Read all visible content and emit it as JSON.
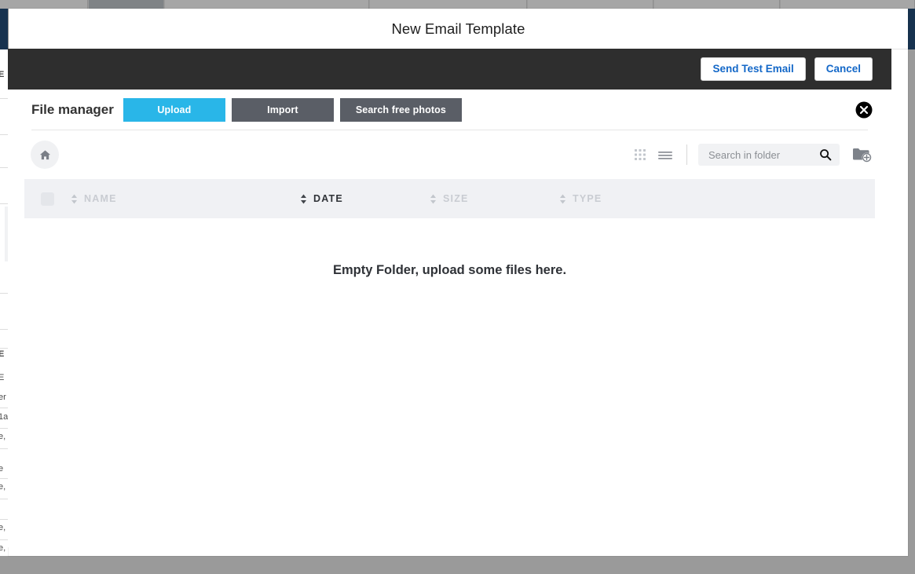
{
  "background": {
    "tabs": [
      {
        "label": ""
      },
      {
        "label": ""
      },
      {
        "label": ""
      },
      {
        "label": ""
      },
      {
        "label": ""
      },
      {
        "label": ""
      },
      {
        "label": ""
      }
    ],
    "left_edge_glyphs": [
      "E",
      "E",
      "E",
      "er",
      "1a",
      "e,",
      "e",
      "e,",
      "e,",
      "e,"
    ]
  },
  "modal": {
    "title": "New Email Template",
    "actions": {
      "send_test_email_label": "Send Test Email",
      "cancel_label": "Cancel"
    }
  },
  "file_manager": {
    "title": "File manager",
    "buttons": {
      "upload_label": "Upload",
      "import_label": "Import",
      "search_free_photos_label": "Search free photos"
    },
    "close_icon": "close-circle-icon",
    "toolbar": {
      "home_icon": "home-icon",
      "grid_view_icon": "grid-view-icon",
      "list_view_icon": "list-view-icon",
      "search_placeholder": "Search in folder",
      "search_value": "",
      "search_icon": "search-icon",
      "new_folder_icon": "new-folder-icon"
    },
    "table": {
      "select_all_checked": false,
      "columns": [
        {
          "key": "name",
          "label": "NAME",
          "sorted": false
        },
        {
          "key": "date",
          "label": "DATE",
          "sorted": true
        },
        {
          "key": "size",
          "label": "SIZE",
          "sorted": false
        },
        {
          "key": "type",
          "label": "TYPE",
          "sorted": false
        }
      ],
      "rows": [],
      "empty_message": "Empty Folder, upload some files here."
    }
  },
  "colors": {
    "accent_blue": "#29b6e8",
    "link_blue": "#1468c8",
    "dark_bar": "#2e2e2e",
    "gray_button": "#5a5e66",
    "table_header_bg": "#f0f1f4",
    "page_backdrop": "#9a9a9a"
  }
}
